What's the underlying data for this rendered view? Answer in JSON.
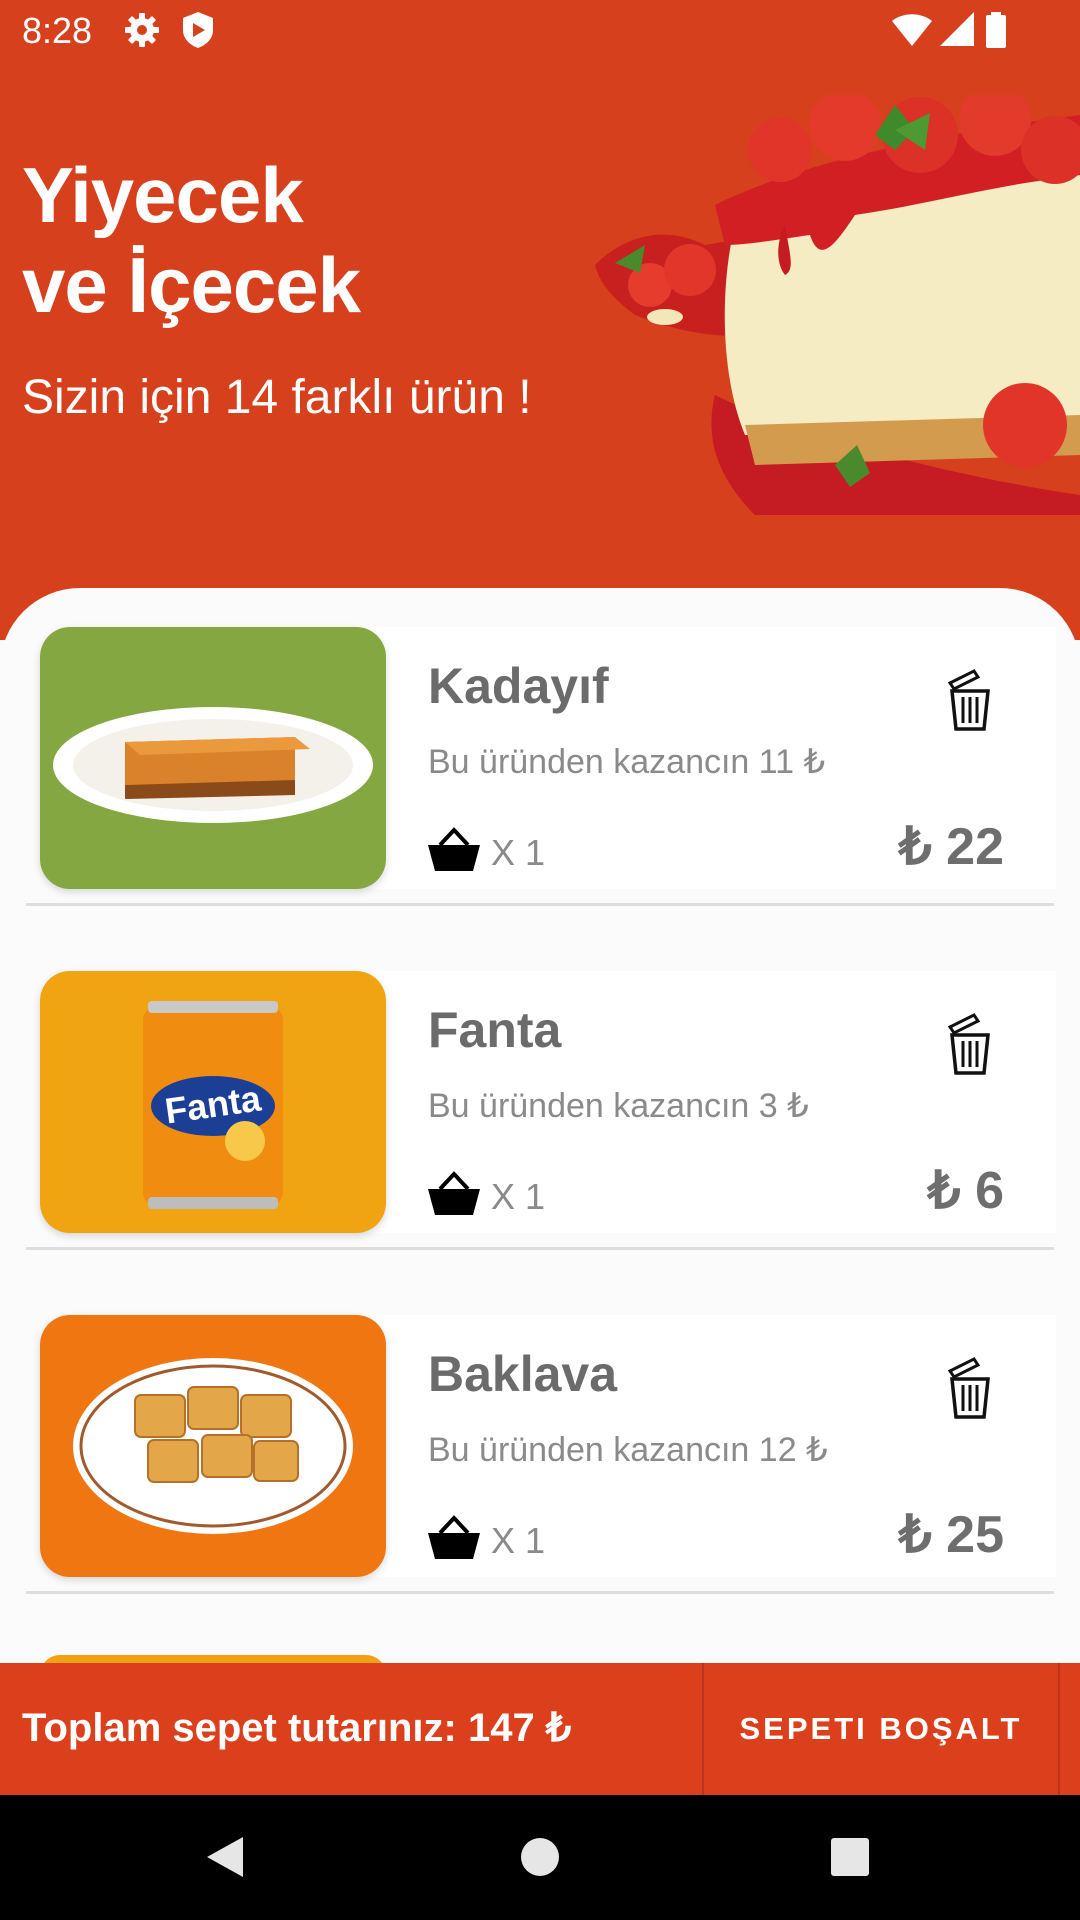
{
  "status": {
    "time": "8:28"
  },
  "header": {
    "title_line1": "Yiyecek",
    "title_line2": "ve İçecek",
    "subtitle": "Sizin için 14 farklı ürün !"
  },
  "items": [
    {
      "name": "Kadayıf",
      "earn": "Bu üründen kazancın 11 ₺",
      "qty": "X 1",
      "price": "₺ 22",
      "thumb_color": "#85a742"
    },
    {
      "name": "Fanta",
      "earn": "Bu üründen kazancın 3 ₺",
      "qty": "X 1",
      "price": "₺ 6",
      "thumb_color": "#f0a412"
    },
    {
      "name": "Baklava",
      "earn": "Bu üründen kazancın 12 ₺",
      "qty": "X 1",
      "price": "₺ 25",
      "thumb_color": "#f07612"
    }
  ],
  "footer": {
    "total": "Toplam sepet tutarınız: 147 ₺",
    "clear_label": "SEPETI BOŞALT"
  },
  "colors": {
    "brand": "#d7401d",
    "footer": "#dc3f1c"
  },
  "icons": [
    "settings-icon",
    "shield-icon",
    "wifi-icon",
    "signal-icon",
    "battery-icon",
    "trash-icon",
    "basket-icon",
    "back-icon",
    "home-icon",
    "recents-icon"
  ]
}
